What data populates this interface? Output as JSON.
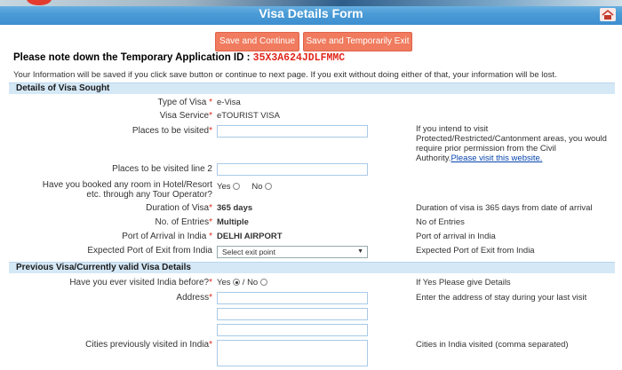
{
  "header": {
    "title": "Visa Details Form"
  },
  "buttons": {
    "save_continue": "Save and Continue",
    "save_exit": "Save and Temporarily Exit"
  },
  "application": {
    "label": "Please note down the Temporary Application ID :",
    "id": "35X3A624JDLFMMC"
  },
  "notice": "Your Information will be saved if you click save button or continue to next page. If you exit without doing either of that, your information will be lost.",
  "sections": {
    "visa_sought": "Details of Visa Sought",
    "previous_visa": "Previous Visa/Currently valid Visa Details"
  },
  "fields": {
    "type_of_visa": {
      "label": "Type of Visa",
      "value": "e-Visa"
    },
    "visa_service": {
      "label": "Visa Service",
      "value": "eTOURIST VISA"
    },
    "places": {
      "label": "Places to be visited",
      "value": ""
    },
    "places_help": "If you intend to visit Protected/Restricted/Cantonment areas, you would require prior permission from the Civil Authority.",
    "places_help_link": "Please visit this website.",
    "places2": {
      "label": "Places to be visited line 2",
      "value": ""
    },
    "hotel_booked": {
      "label_1": "Have you booked any room in Hotel/Resort",
      "label_2": "etc. through any Tour Operator?",
      "yes": "Yes",
      "no": "No",
      "selected": "none"
    },
    "duration": {
      "label": "Duration of Visa",
      "value": "365 days",
      "help": "Duration of visa is 365 days from date of arrival"
    },
    "entries": {
      "label": "No. of Entries",
      "value": "Multiple",
      "help": "No of Entries"
    },
    "port_arrival": {
      "label": "Port of Arrival in India",
      "value": "DELHI AIRPORT",
      "help": "Port of arrival in India"
    },
    "port_exit": {
      "label": "Expected Port of Exit from India",
      "value": "Select exit point",
      "help": "Expected Port of Exit from India"
    },
    "visited_before": {
      "label": "Have you ever visited India before?",
      "yes": "Yes",
      "no": "No",
      "separator": "/",
      "selected": "yes",
      "help": "If Yes Please give Details"
    },
    "address": {
      "label": "Address",
      "help": "Enter the address of stay during your last visit"
    },
    "cities": {
      "label": "Cities previously visited in India",
      "help": "Cities in India visited (comma separated)"
    }
  },
  "required_mark": "*"
}
